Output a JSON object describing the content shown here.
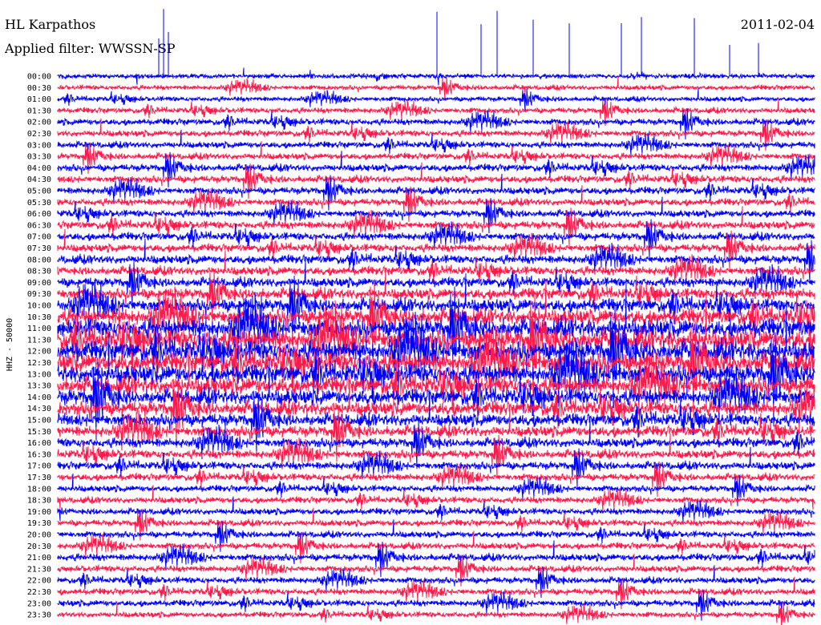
{
  "header": {
    "station": "HL Karpathos",
    "date": "2011-02-04",
    "filter": "Applied filter: WWSSN-SP"
  },
  "chart_data": {
    "type": "line",
    "title": "HL Karpathos",
    "subtitle": "Applied filter: WWSSN-SP",
    "date": "2011-02-04",
    "ylabel": "HHZ - 50000",
    "row_interval_minutes": 30,
    "colors": {
      "even_rows": "#0000ff",
      "odd_rows": "#ff1a4b"
    },
    "row_labels": [
      "00:00",
      "00:30",
      "01:00",
      "01:30",
      "02:00",
      "02:30",
      "03:00",
      "03:30",
      "04:00",
      "04:30",
      "05:00",
      "05:30",
      "06:00",
      "06:30",
      "07:00",
      "07:30",
      "08:00",
      "08:30",
      "09:00",
      "09:30",
      "10:00",
      "10:30",
      "11:00",
      "11:30",
      "12:00",
      "12:30",
      "13:00",
      "13:30",
      "14:00",
      "14:30",
      "15:00",
      "15:30",
      "16:00",
      "16:30",
      "17:00",
      "17:30",
      "18:00",
      "18:30",
      "19:00",
      "19:30",
      "20:00",
      "20:30",
      "21:00",
      "21:30",
      "22:00",
      "22:30",
      "23:00",
      "23:30"
    ],
    "relative_noise_amplitude": [
      0.6,
      0.6,
      0.6,
      0.7,
      0.8,
      0.8,
      0.8,
      0.8,
      0.9,
      0.9,
      0.9,
      0.9,
      0.9,
      1.0,
      1.0,
      1.0,
      1.1,
      1.1,
      1.2,
      1.4,
      1.7,
      2.0,
      2.4,
      2.6,
      2.6,
      2.5,
      2.4,
      2.2,
      2.0,
      1.8,
      1.6,
      1.4,
      1.2,
      1.1,
      1.0,
      0.9,
      0.8,
      0.8,
      0.8,
      0.8,
      0.8,
      0.8,
      0.9,
      0.8,
      0.8,
      0.8,
      0.8,
      0.7
    ]
  }
}
